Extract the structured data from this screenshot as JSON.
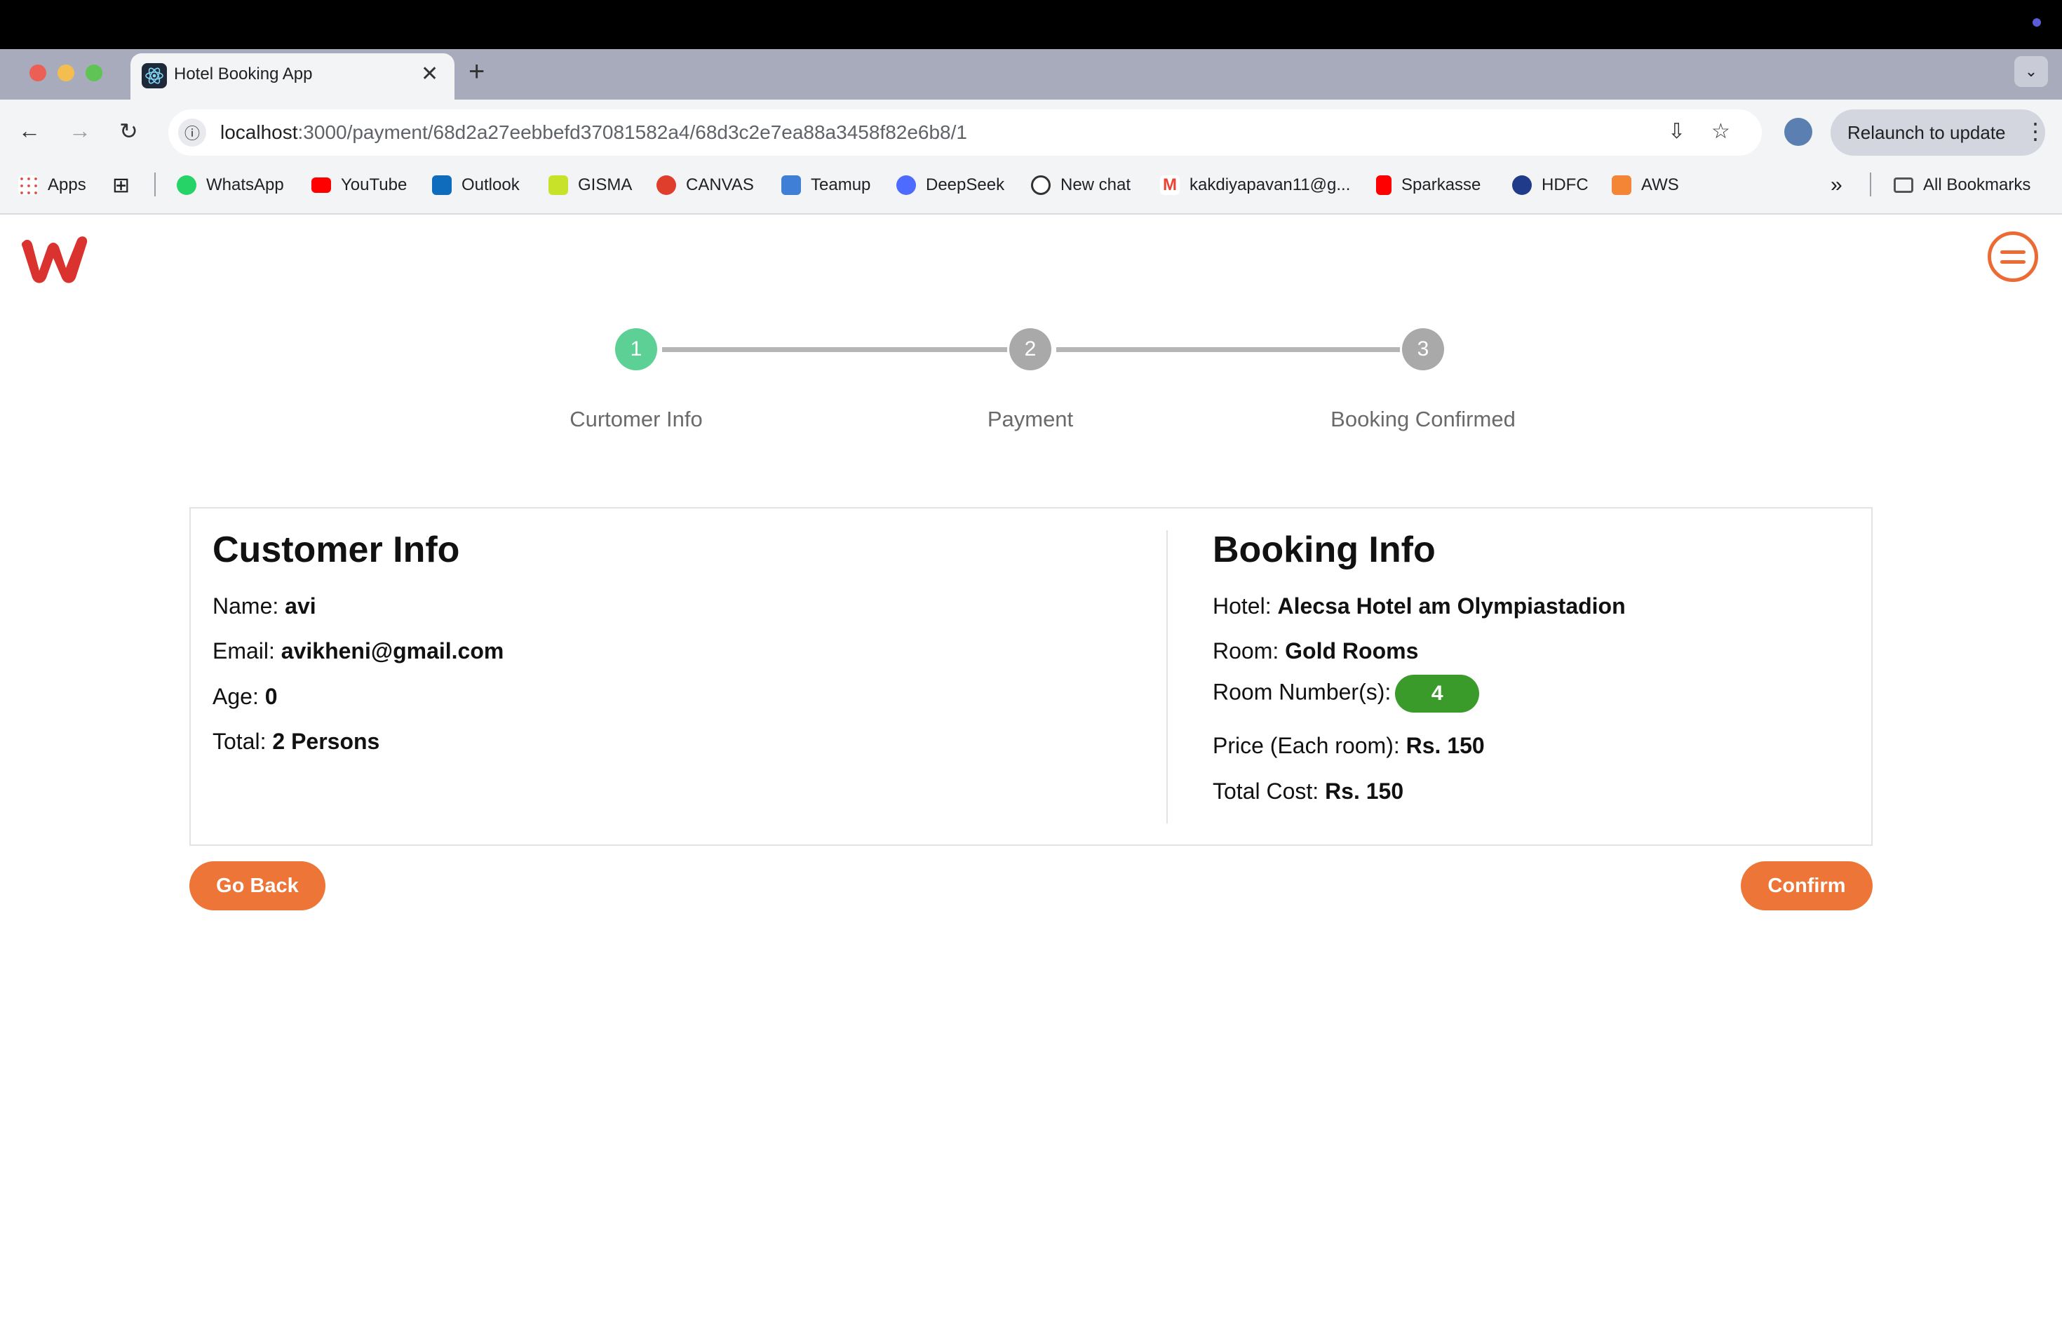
{
  "browser": {
    "tab_title": "Hotel Booking App",
    "url_host": "localhost",
    "url_path": ":3000/payment/68d2a27eebbefd37081582a4/68d3c2e7ea88a3458f82e6b8/1",
    "relaunch_label": "Relaunch to update",
    "bookmarks": {
      "apps": "Apps",
      "whatsapp": "WhatsApp",
      "youtube": "YouTube",
      "outlook": "Outlook",
      "gisma": "GISMA",
      "canvas": "CANVAS",
      "teamup": "Teamup",
      "deepseek": "DeepSeek",
      "newchat": "New chat",
      "gmail": "kakdiyapavan11@g...",
      "sparkasse": "Sparkasse",
      "hdfc": "HDFC",
      "aws": "AWS",
      "all": "All Bookmarks"
    }
  },
  "stepper": {
    "steps": [
      {
        "number": "1",
        "label": "Curtomer Info",
        "state": "active"
      },
      {
        "number": "2",
        "label": "Payment",
        "state": "inactive"
      },
      {
        "number": "3",
        "label": "Booking Confirmed",
        "state": "inactive"
      }
    ]
  },
  "customer": {
    "heading": "Customer Info",
    "name_label": "Name:",
    "name": "avi",
    "email_label": "Email:",
    "email": "avikheni@gmail.com",
    "age_label": "Age:",
    "age": "0",
    "total_label": "Total:",
    "total": "2 Persons"
  },
  "booking": {
    "heading": "Booking Info",
    "hotel_label": "Hotel:",
    "hotel": "Alecsa Hotel am Olympiastadion",
    "room_label": "Room:",
    "room": "Gold Rooms",
    "room_numbers_label": "Room Number(s):",
    "room_number": "4",
    "price_label": "Price (Each room):",
    "price": "Rs. 150",
    "total_cost_label": "Total Cost:",
    "total_cost": "Rs. 150"
  },
  "actions": {
    "back": "Go Back",
    "confirm": "Confirm"
  },
  "colors": {
    "accent": "#ec7537",
    "step_active": "#5cd095",
    "step_inactive": "#a9a9a9",
    "room_pill": "#3a9a2a",
    "logo": "#d9322f"
  }
}
